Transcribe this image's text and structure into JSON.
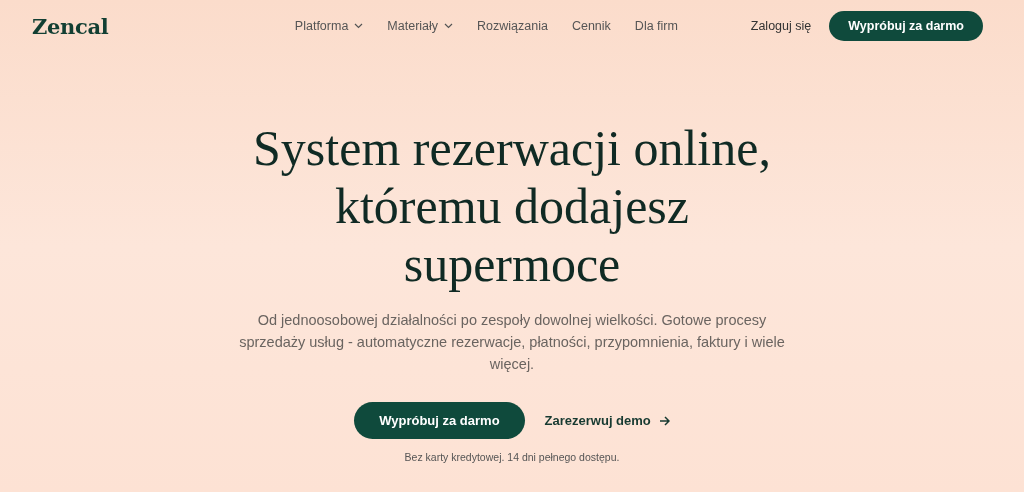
{
  "header": {
    "logo": "Zencal",
    "nav": [
      {
        "label": "Platforma",
        "has_menu": true
      },
      {
        "label": "Materiały",
        "has_menu": true
      },
      {
        "label": "Rozwiązania",
        "has_menu": false
      },
      {
        "label": "Cennik",
        "has_menu": false
      },
      {
        "label": "Dla firm",
        "has_menu": false
      }
    ],
    "login": "Zaloguj się",
    "cta": "Wypróbuj za darmo"
  },
  "hero": {
    "title": "System rezerwacji online, któremu dodajesz supermoce",
    "subtitle": "Od jednoosobowej działalności po zespoły dowolnej wielkości. Gotowe procesy sprzedaży usług - automatyczne rezerwacje, płatności, przypomnienia, faktury i wiele więcej.",
    "primary_button": "Wypróbuj za darmo",
    "secondary_link": "Zarezerwuj demo",
    "note": "Bez karty kredytowej. 14 dni pełnego dostępu."
  }
}
